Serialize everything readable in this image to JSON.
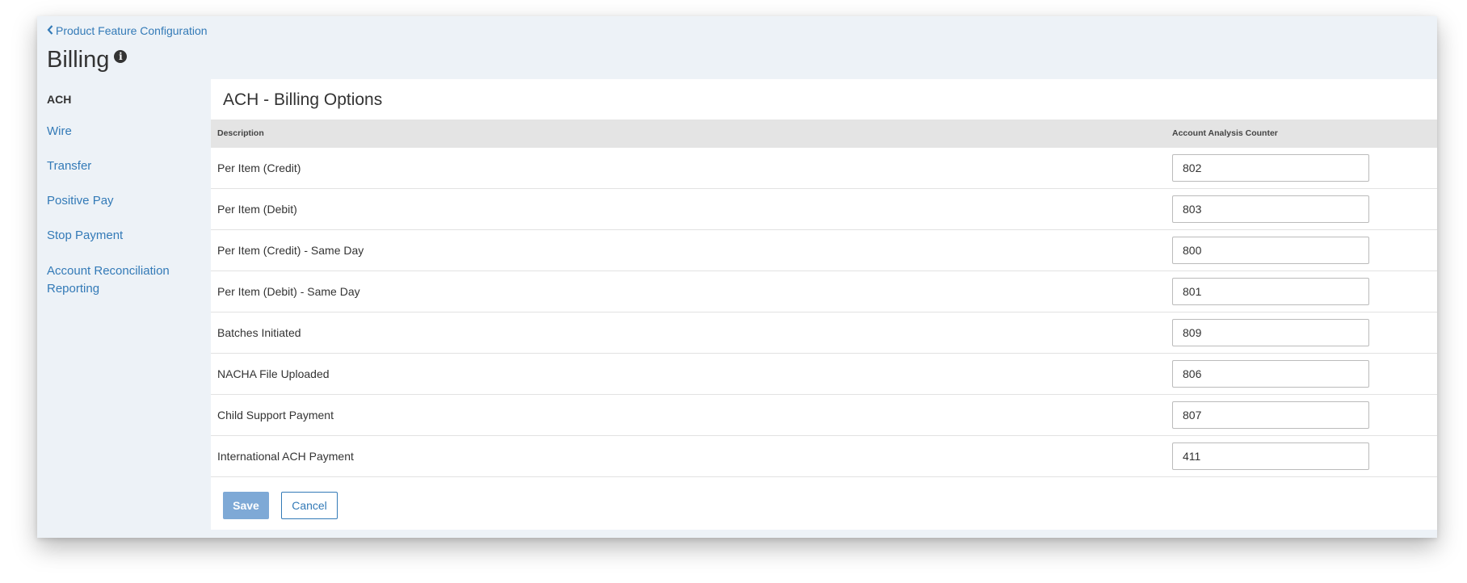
{
  "header": {
    "back_link": "Product Feature Configuration",
    "title": "Billing"
  },
  "sidebar": {
    "items": [
      {
        "label": "ACH",
        "active": true
      },
      {
        "label": "Wire"
      },
      {
        "label": "Transfer"
      },
      {
        "label": "Positive Pay"
      },
      {
        "label": "Stop Payment"
      },
      {
        "label": "Account Reconciliation Reporting"
      }
    ]
  },
  "panel": {
    "title": "ACH - Billing Options",
    "columns": [
      "Description",
      "Account Analysis Counter"
    ],
    "rows": [
      {
        "description": "Per Item (Credit)",
        "counter": "802"
      },
      {
        "description": "Per Item (Debit)",
        "counter": "803"
      },
      {
        "description": "Per Item (Credit) - Same Day",
        "counter": "800"
      },
      {
        "description": "Per Item (Debit) - Same Day",
        "counter": "801"
      },
      {
        "description": "Batches Initiated",
        "counter": "809"
      },
      {
        "description": "NACHA File Uploaded",
        "counter": "806"
      },
      {
        "description": "Child Support Payment",
        "counter": "807"
      },
      {
        "description": "International ACH Payment",
        "counter": "411"
      }
    ],
    "save_label": "Save",
    "cancel_label": "Cancel"
  },
  "colors": {
    "link": "#337ab7",
    "save_button": "#7ea9d6",
    "page_background": "#edf2f7",
    "table_header": "#e4e4e4"
  },
  "icons": {
    "back": "chevron-left-icon",
    "info": "info-circle-icon"
  }
}
